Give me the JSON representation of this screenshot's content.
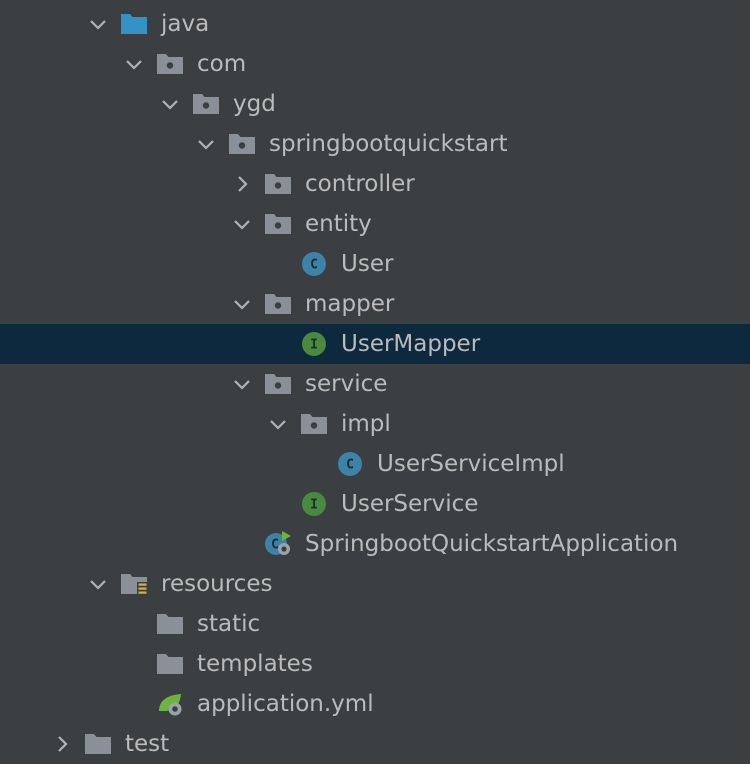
{
  "colors": {
    "background": "#3c3f41",
    "selection": "#0d293e",
    "text": "#bbbbbb",
    "folder": "#8a9097",
    "source_root_folder": "#3592c4",
    "class_icon": "#3d83a8",
    "interface_icon": "#4a8a3f",
    "spring_green": "#6db33f"
  },
  "tree": [
    {
      "label": "java",
      "level": 3,
      "expanded": true,
      "icon": "source-folder-icon",
      "kind": "folder"
    },
    {
      "label": "com",
      "level": 4,
      "expanded": true,
      "icon": "package-folder-icon",
      "kind": "folder"
    },
    {
      "label": "ygd",
      "level": 5,
      "expanded": true,
      "icon": "package-folder-icon",
      "kind": "folder"
    },
    {
      "label": "springbootquickstart",
      "level": 6,
      "expanded": true,
      "icon": "package-folder-icon",
      "kind": "folder"
    },
    {
      "label": "controller",
      "level": 7,
      "expanded": false,
      "icon": "package-folder-icon",
      "kind": "folder"
    },
    {
      "label": "entity",
      "level": 7,
      "expanded": true,
      "icon": "package-folder-icon",
      "kind": "folder"
    },
    {
      "label": "User",
      "level": 8,
      "icon": "class-icon",
      "kind": "file"
    },
    {
      "label": "mapper",
      "level": 7,
      "expanded": true,
      "icon": "package-folder-icon",
      "kind": "folder"
    },
    {
      "label": "UserMapper",
      "level": 8,
      "icon": "interface-icon",
      "kind": "file",
      "selected": true
    },
    {
      "label": "service",
      "level": 7,
      "expanded": true,
      "icon": "package-folder-icon",
      "kind": "folder"
    },
    {
      "label": "impl",
      "level": 8,
      "expanded": true,
      "icon": "package-folder-icon",
      "kind": "folder"
    },
    {
      "label": "UserServiceImpl",
      "level": 9,
      "icon": "class-icon",
      "kind": "file"
    },
    {
      "label": "UserService",
      "level": 8,
      "icon": "interface-icon",
      "kind": "file"
    },
    {
      "label": "SpringbootQuickstartApplication",
      "level": 7,
      "icon": "spring-boot-app-icon",
      "kind": "file"
    },
    {
      "label": "resources",
      "level": 3,
      "expanded": true,
      "icon": "resources-folder-icon",
      "kind": "folder"
    },
    {
      "label": "static",
      "level": 4,
      "icon": "folder-icon",
      "kind": "file"
    },
    {
      "label": "templates",
      "level": 4,
      "icon": "folder-icon",
      "kind": "file"
    },
    {
      "label": "application.yml",
      "level": 4,
      "icon": "spring-config-icon",
      "kind": "file"
    },
    {
      "label": "test",
      "level": 2,
      "expanded": false,
      "icon": "folder-icon",
      "kind": "folder"
    }
  ]
}
